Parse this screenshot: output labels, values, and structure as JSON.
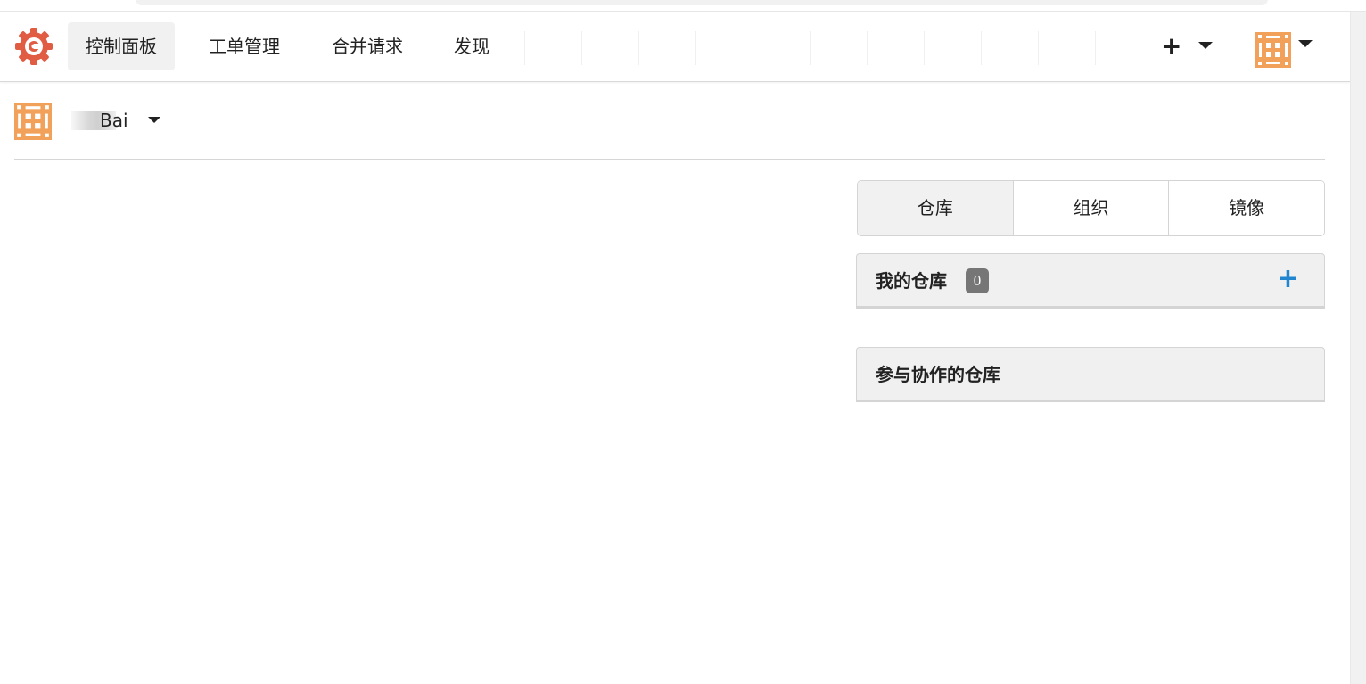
{
  "nav": {
    "items": [
      {
        "label": "控制面板",
        "active": true
      },
      {
        "label": "工单管理",
        "active": false
      },
      {
        "label": "合并请求",
        "active": false
      },
      {
        "label": "发现",
        "active": false
      }
    ],
    "create_label": "+"
  },
  "user": {
    "name_suffix": "Bai"
  },
  "tabs": [
    {
      "label": "仓库",
      "active": true
    },
    {
      "label": "组织",
      "active": false
    },
    {
      "label": "镜像",
      "active": false
    }
  ],
  "my_repos": {
    "title": "我的仓库",
    "count": "0",
    "add_label": "+"
  },
  "collab_repos": {
    "title": "参与协作的仓库"
  },
  "colors": {
    "logo": "#e05d44",
    "avatar": "#f2a15a",
    "accent": "#2185d0",
    "badge": "#767676"
  }
}
